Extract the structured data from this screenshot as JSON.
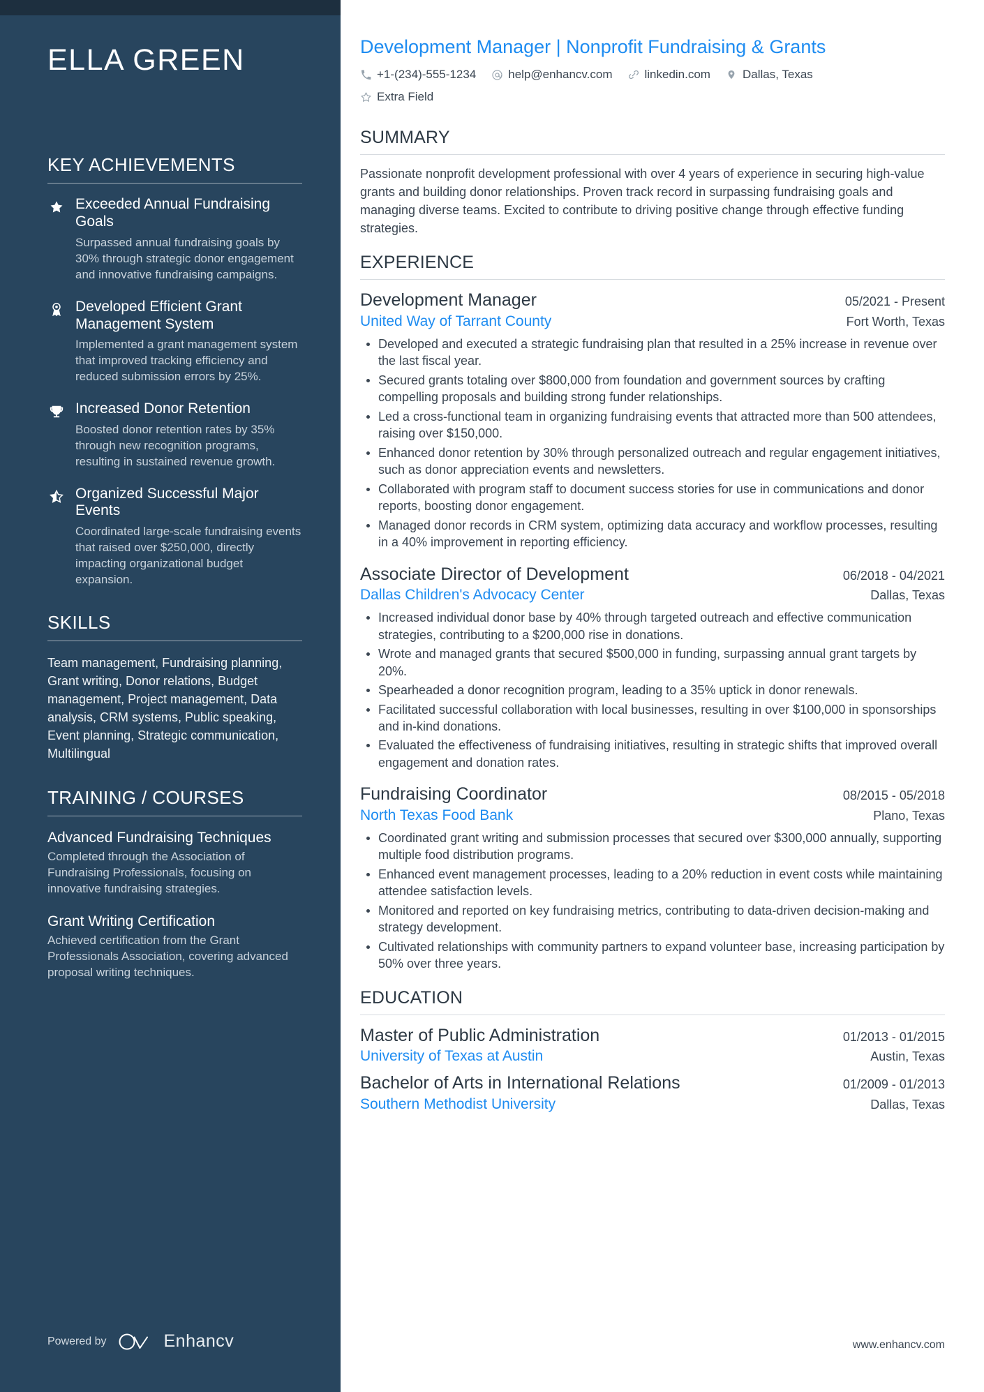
{
  "sidebar": {
    "name": "ELLA GREEN",
    "sections": {
      "achievements_title": "KEY ACHIEVEMENTS",
      "skills_title": "SKILLS",
      "training_title": "TRAINING / COURSES"
    },
    "achievements": [
      {
        "icon": "star-filled-icon",
        "title": "Exceeded Annual Fundraising Goals",
        "description": "Surpassed annual fundraising goals by 30% through strategic donor engagement and innovative fundraising campaigns."
      },
      {
        "icon": "award-rosette-icon",
        "title": "Developed Efficient Grant Management System",
        "description": "Implemented a grant management system that improved tracking efficiency and reduced submission errors by 25%."
      },
      {
        "icon": "trophy-icon",
        "title": "Increased Donor Retention",
        "description": "Boosted donor retention rates by 35% through new recognition programs, resulting in sustained revenue growth."
      },
      {
        "icon": "star-half-icon",
        "title": "Organized Successful Major Events",
        "description": "Coordinated large-scale fundraising events that raised over $250,000, directly impacting organizational budget expansion."
      }
    ],
    "skills_text": "Team management, Fundraising planning, Grant writing, Donor relations, Budget management, Project management, Data analysis, CRM systems, Public speaking, Event planning, Strategic communication, Multilingual",
    "courses": [
      {
        "title": "Advanced Fundraising Techniques",
        "description": "Completed through the Association of Fundraising Professionals, focusing on innovative fundraising strategies."
      },
      {
        "title": "Grant Writing Certification",
        "description": "Achieved certification from the Grant Professionals Association, covering advanced proposal writing techniques."
      }
    ],
    "footer": {
      "powered_by": "Powered by",
      "brand": "Enhancv"
    }
  },
  "main": {
    "headline": "Development Manager | Nonprofit Fundraising & Grants",
    "contacts": [
      {
        "icon": "phone-icon",
        "text": "+1-(234)-555-1234"
      },
      {
        "icon": "at-email-icon",
        "text": "help@enhancv.com"
      },
      {
        "icon": "link-icon",
        "text": "linkedin.com"
      },
      {
        "icon": "location-pin-icon",
        "text": "Dallas, Texas"
      },
      {
        "icon": "star-outline-icon",
        "text": "Extra Field"
      }
    ],
    "summary": {
      "title": "SUMMARY",
      "text": "Passionate nonprofit development professional with over 4 years of experience in securing high-value grants and building donor relationships. Proven track record in surpassing fundraising goals and managing diverse teams. Excited to contribute to driving positive change through effective funding strategies."
    },
    "experience": {
      "title": "EXPERIENCE",
      "entries": [
        {
          "role": "Development Manager",
          "date": "05/2021 - Present",
          "organization": "United Way of Tarrant County",
          "location": "Fort Worth, Texas",
          "bullets": [
            "Developed and executed a strategic fundraising plan that resulted in a 25% increase in revenue over the last fiscal year.",
            "Secured grants totaling over $800,000 from foundation and government sources by crafting compelling proposals and building strong funder relationships.",
            "Led a cross-functional team in organizing fundraising events that attracted more than 500 attendees, raising over $150,000.",
            "Enhanced donor retention by 30% through personalized outreach and regular engagement initiatives, such as donor appreciation events and newsletters.",
            "Collaborated with program staff to document success stories for use in communications and donor reports, boosting donor engagement.",
            "Managed donor records in CRM system, optimizing data accuracy and workflow processes, resulting in a 40% improvement in reporting efficiency."
          ]
        },
        {
          "role": "Associate Director of Development",
          "date": "06/2018 - 04/2021",
          "organization": "Dallas Children's Advocacy Center",
          "location": "Dallas, Texas",
          "bullets": [
            "Increased individual donor base by 40% through targeted outreach and effective communication strategies, contributing to a $200,000 rise in donations.",
            "Wrote and managed grants that secured $500,000 in funding, surpassing annual grant targets by 20%.",
            "Spearheaded a donor recognition program, leading to a 35% uptick in donor renewals.",
            "Facilitated successful collaboration with local businesses, resulting in over $100,000 in sponsorships and in-kind donations.",
            "Evaluated the effectiveness of fundraising initiatives, resulting in strategic shifts that improved overall engagement and donation rates."
          ]
        },
        {
          "role": "Fundraising Coordinator",
          "date": "08/2015 - 05/2018",
          "organization": "North Texas Food Bank",
          "location": "Plano, Texas",
          "bullets": [
            "Coordinated grant writing and submission processes that secured over $300,000 annually, supporting multiple food distribution programs.",
            "Enhanced event management processes, leading to a 20% reduction in event costs while maintaining attendee satisfaction levels.",
            "Monitored and reported on key fundraising metrics, contributing to data-driven decision-making and strategy development.",
            "Cultivated relationships with community partners to expand volunteer base, increasing participation by 50% over three years."
          ]
        }
      ]
    },
    "education": {
      "title": "EDUCATION",
      "entries": [
        {
          "degree": "Master of Public Administration",
          "date": "01/2013 - 01/2015",
          "school": "University of Texas at Austin",
          "location": "Austin, Texas"
        },
        {
          "degree": "Bachelor of Arts in International Relations",
          "date": "01/2009 - 01/2013",
          "school": "Southern Methodist University",
          "location": "Dallas, Texas"
        }
      ]
    },
    "footer_url": "www.enhancv.com"
  },
  "colors": {
    "sidebar_bg": "#28455e",
    "sidebar_top_strip": "#1d2f3f",
    "accent_blue": "#1e8cf1",
    "body_text": "#3b4652",
    "heading_text": "#2d3944"
  }
}
